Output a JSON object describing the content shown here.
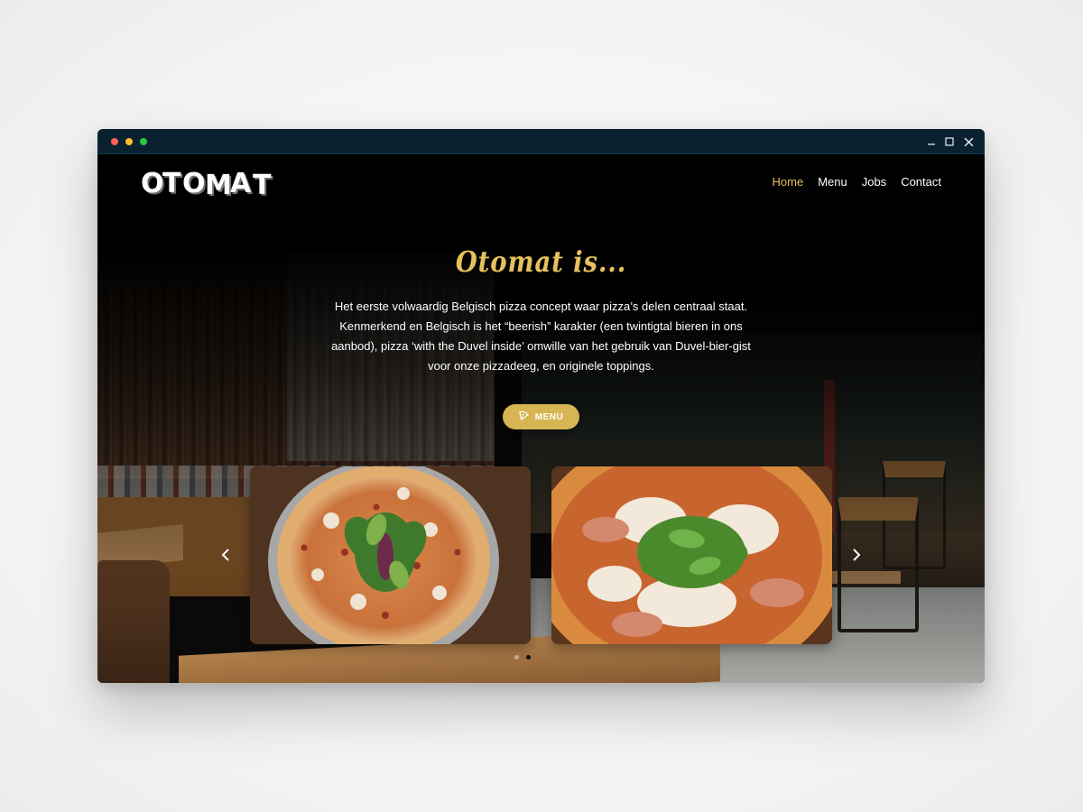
{
  "window": {
    "controls": {
      "minimize_icon": "minimize-icon",
      "maximize_icon": "maximize-icon",
      "close_icon": "close-icon"
    }
  },
  "site": {
    "logo_text": "OTOMAT",
    "nav": [
      {
        "label": "Home",
        "active": true
      },
      {
        "label": "Menu",
        "active": false
      },
      {
        "label": "Jobs",
        "active": false
      },
      {
        "label": "Contact",
        "active": false
      }
    ]
  },
  "hero": {
    "title": "Otomat is...",
    "text": "Het eerste volwaardig Belgisch pizza concept waar pizza’s delen centraal staat. Kenmerkend en Belgisch is het “beerish” karakter (een twintigtal bieren in ons aanbod), pizza ‘with the Duvel inside’ omwille van het gebruik van Duvel-bier-gist voor onze pizzadeeg, en originele toppings.",
    "button_label": "MENU",
    "button_icon": "pizza-slice-icon"
  },
  "carousel": {
    "prev_icon": "chevron-left-icon",
    "next_icon": "chevron-right-icon",
    "slides": [
      "pizza-mushroom-salad-photo",
      "pizza-prosciutto-arugula-photo"
    ],
    "dots": 2,
    "active_dot": 2
  },
  "colors": {
    "accent": "#e6c15b",
    "button": "#d7b552",
    "titlebar": "#0a2230",
    "text": "#ffffff"
  }
}
